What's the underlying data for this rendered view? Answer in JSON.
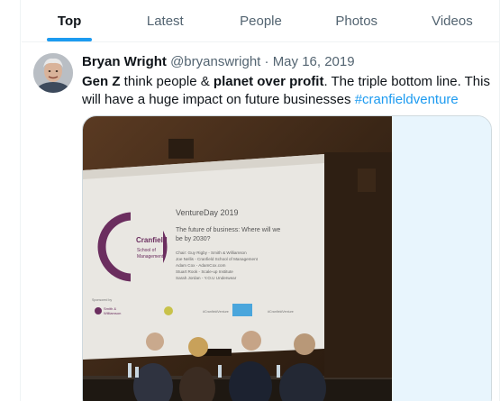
{
  "tabs": [
    {
      "label": "Top",
      "active": true
    },
    {
      "label": "Latest",
      "active": false
    },
    {
      "label": "People",
      "active": false
    },
    {
      "label": "Photos",
      "active": false
    },
    {
      "label": "Videos",
      "active": false
    }
  ],
  "tweet": {
    "author_name": "Bryan Wright",
    "handle": "@bryanswright",
    "separator": "·",
    "date": "May 16, 2019",
    "text_parts": {
      "bold1": "Gen Z",
      "plain1": " think people & ",
      "bold2": "planet over profit",
      "plain2": ". The triple bottom line. This will have a huge impact on future businesses ",
      "hashtag": "#cranfieldventure"
    }
  },
  "slide": {
    "logo_word": "Cranfield",
    "logo_sub1": "School of",
    "logo_sub2": "Management",
    "title": "VentureDay 2019",
    "question_line1": "The future of business: Where will we",
    "question_line2": "be by 2030?",
    "panel_lines": [
      "Chair: Guy Rigby - Smith & Williamson",
      "Joe Nellis - Cranfield School of Management",
      "Adam Cox - AdamCox.com",
      "Stuart Rook - Scale-up Institute",
      "Sarah Jordan - Y.O.U Underwear"
    ],
    "sponsored_by": "Sponsored by",
    "sponsor_name1": "Smith &",
    "sponsor_name2": "Williamson",
    "footer_tag1": "#CranfieldVenture",
    "footer_tag2": "#CranfieldVenture"
  },
  "colors": {
    "accent": "#1d9bf0",
    "text": "#0f1419",
    "muted": "#536471",
    "border": "#cfd9de",
    "logo_purple": "#6b2e5f"
  }
}
